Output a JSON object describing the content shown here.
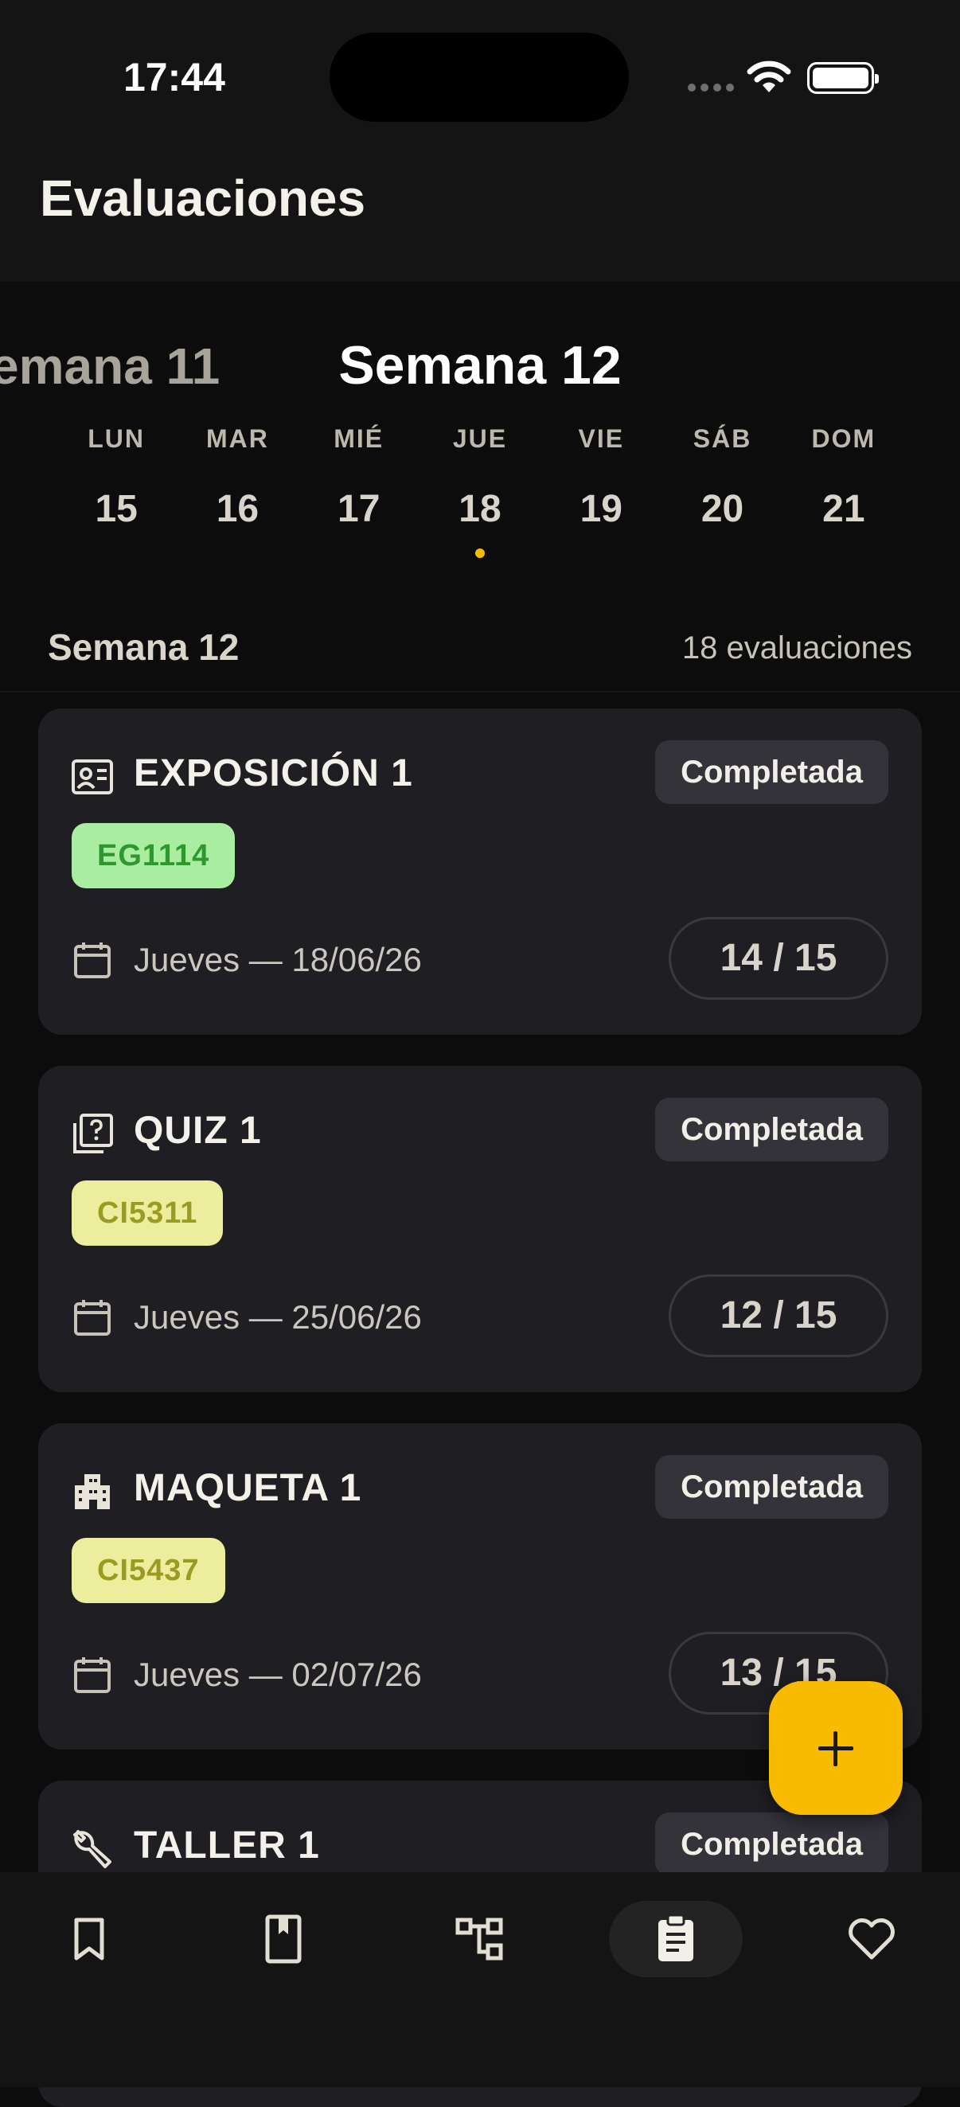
{
  "status_bar": {
    "time": "17:44"
  },
  "header": {
    "title": "Evaluaciones"
  },
  "week_selector": {
    "previous_label": "emana 11",
    "current_label": "Semana 12",
    "days": [
      {
        "name": "LUN",
        "number": "15",
        "has_event": false
      },
      {
        "name": "MAR",
        "number": "16",
        "has_event": false
      },
      {
        "name": "MIÉ",
        "number": "17",
        "has_event": false
      },
      {
        "name": "JUE",
        "number": "18",
        "has_event": true
      },
      {
        "name": "VIE",
        "number": "19",
        "has_event": false
      },
      {
        "name": "SÁB",
        "number": "20",
        "has_event": false
      },
      {
        "name": "DOM",
        "number": "21",
        "has_event": false
      }
    ]
  },
  "section": {
    "title": "Semana 12",
    "count": "18 evaluaciones"
  },
  "evaluations": [
    {
      "icon": "presentation-icon",
      "title": "EXPOSICIÓN 1",
      "status": "Completada",
      "code": "EG1114",
      "code_color": "#a9eea0",
      "date": "Jueves — 18/06/26",
      "score": "14 / 15"
    },
    {
      "icon": "quiz-icon",
      "title": "QUIZ 1",
      "status": "Completada",
      "code": "CI5311",
      "code_color": "#eced9d",
      "date": "Jueves — 25/06/26",
      "score": "12 / 15"
    },
    {
      "icon": "building-icon",
      "title": "MAQUETA 1",
      "status": "Completada",
      "code": "CI5437",
      "code_color": "#eced9d",
      "date": "Jueves — 02/07/26",
      "score": "13 / 15"
    },
    {
      "icon": "wrench-icon",
      "title": "TALLER 1",
      "status": "Completada"
    }
  ],
  "fab": {
    "icon": "plus-icon"
  },
  "bottom_nav": [
    {
      "icon": "bookmark-icon",
      "active": false
    },
    {
      "icon": "book-icon",
      "active": false
    },
    {
      "icon": "tree-icon",
      "active": false
    },
    {
      "icon": "clipboard-icon",
      "active": true
    },
    {
      "icon": "heart-icon",
      "active": false
    }
  ],
  "colors": {
    "accent": "#f9bb00",
    "background": "#0c0c0c",
    "card": "#1f1e23"
  }
}
